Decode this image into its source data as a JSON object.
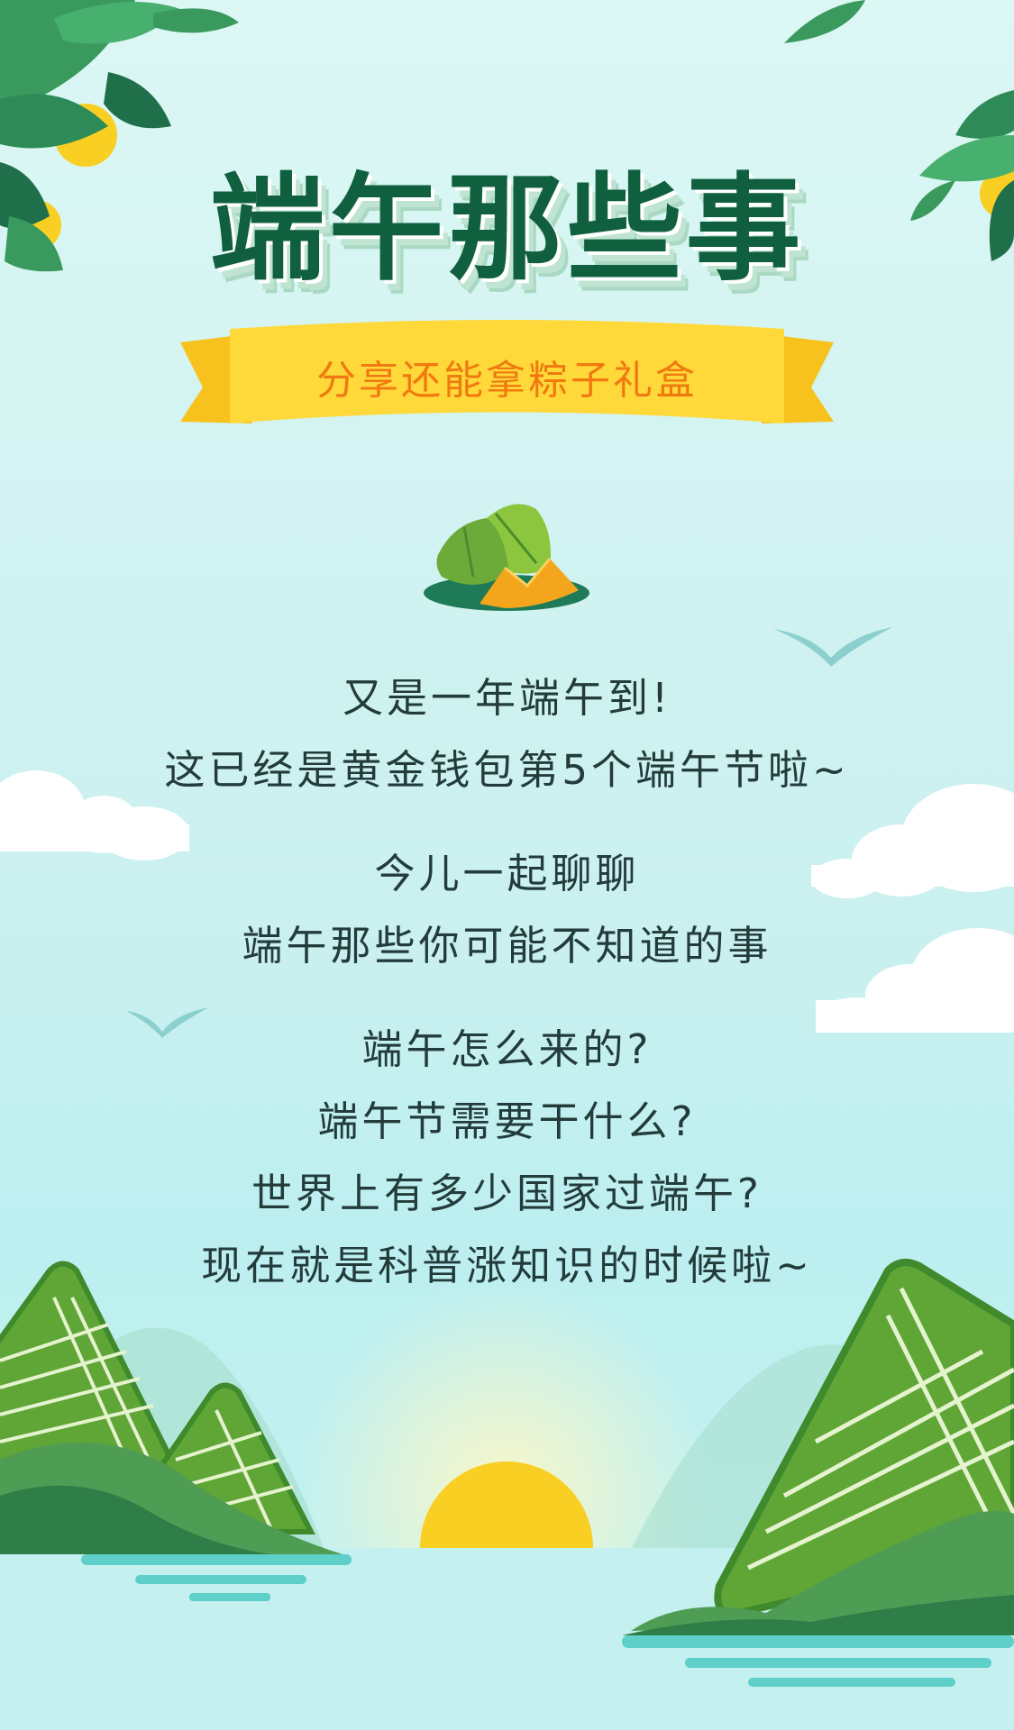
{
  "header": {
    "title": "端午那些事",
    "banner": "分享还能拿粽子礼盒"
  },
  "content": {
    "intro": [
      "又是一年端午到!",
      "这已经是黄金钱包第5个端午节啦~"
    ],
    "invite": [
      "今儿一起聊聊",
      "端午那些你可能不知道的事"
    ],
    "questions": [
      "端午怎么来的?",
      "端午节需要干什么?",
      "世界上有多少国家过端午?",
      "现在就是科普涨知识的时候啦~"
    ]
  },
  "colors": {
    "title": "#10603f",
    "banner_text": "#f07a10",
    "ribbon": "#ffd83a",
    "body_text": "#233b3b",
    "zongzi_green": "#5fa637",
    "sun": "#f8cf22"
  },
  "icons": [
    "leaf-branch-icon",
    "zongzi-icon",
    "bird-icon",
    "cloud-icon",
    "sun-icon",
    "mountain-zongzi-icon"
  ]
}
